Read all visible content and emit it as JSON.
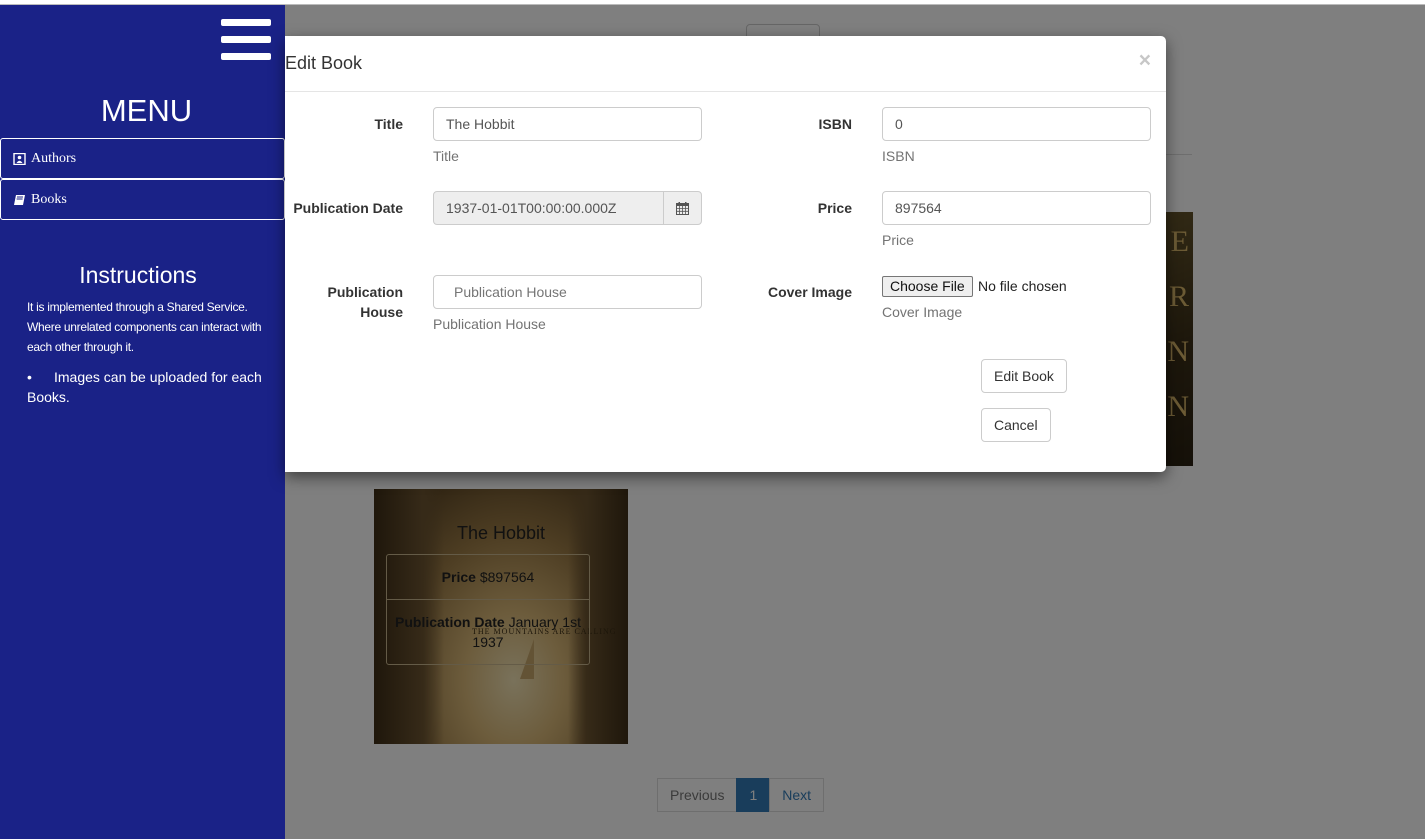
{
  "page": {
    "book_card": {
      "title": "The Hobbit",
      "price_label": "Price",
      "price_value": "$897564",
      "date_label": "Publication Date",
      "date_value": "January 1st 1937",
      "cover_tagline": "THE MOUNTAINS ARE CALLING"
    },
    "second_cover_letters": [
      "E",
      "R",
      "N",
      "N"
    ],
    "pagination": {
      "previous": "Previous",
      "current": "1",
      "next": "Next"
    }
  },
  "sidebar": {
    "menu_title": "MENU",
    "items": [
      {
        "label": "Authors",
        "icon": "address-book-icon"
      },
      {
        "label": "Books",
        "icon": "book-icon"
      }
    ],
    "instructions_title": "Instructions",
    "instructions_text": "It is implemented through a Shared Service. Where unrelated components can interact with each other through it.",
    "instructions_bullet": "Images can be uploaded for each Books."
  },
  "modal": {
    "title": "Edit Book",
    "close": "×",
    "fields": {
      "title": {
        "label": "Title",
        "value": "The Hobbit",
        "help": "Title"
      },
      "isbn": {
        "label": "ISBN",
        "value": "0",
        "help": "ISBN"
      },
      "publication_date": {
        "label": "Publication Date",
        "value": "1937-01-01T00:00:00.000Z"
      },
      "price": {
        "label": "Price",
        "value": "897564",
        "help": "Price"
      },
      "publication_house": {
        "label_line1": "Publication",
        "label_line2": "House",
        "placeholder": "Publication House",
        "help": "Publication House"
      },
      "cover_image": {
        "label": "Cover Image",
        "button": "Choose File",
        "status": "No file chosen",
        "help": "Cover Image"
      }
    },
    "buttons": {
      "submit": "Edit Book",
      "cancel": "Cancel"
    }
  }
}
